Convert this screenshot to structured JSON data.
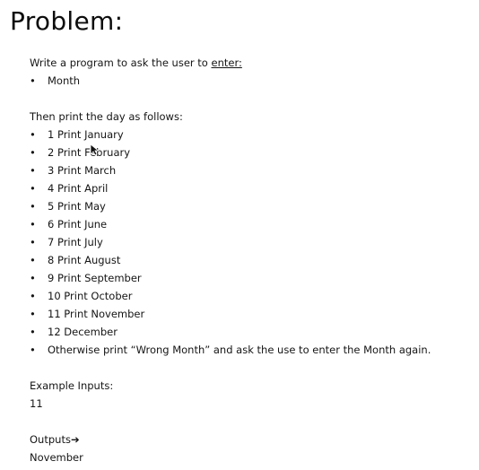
{
  "title": "Problem:",
  "intro": {
    "prefix": "Write a program to ask the user to ",
    "emphasis": "enter:"
  },
  "inputs": [
    "Month"
  ],
  "instruction": "Then print the day as follows:",
  "rules": [
    "1 Print January",
    "2 Print February",
    "3 Print March",
    "4 Print April",
    "5 Print May",
    "6 Print June",
    "7 Print July",
    "8 Print August",
    "9 Print September",
    "10 Print October",
    "11 Print November",
    "12 December",
    "Otherwise print “Wrong Month” and ask the use to enter the Month again."
  ],
  "bullet_glyph": "•",
  "example": {
    "inputs_label": "Example Inputs:",
    "input_value": "11",
    "outputs_label": "Outputs",
    "outputs_arrow": "➔",
    "output_value": "November"
  },
  "cursor_icon": "mouse-pointer-icon"
}
